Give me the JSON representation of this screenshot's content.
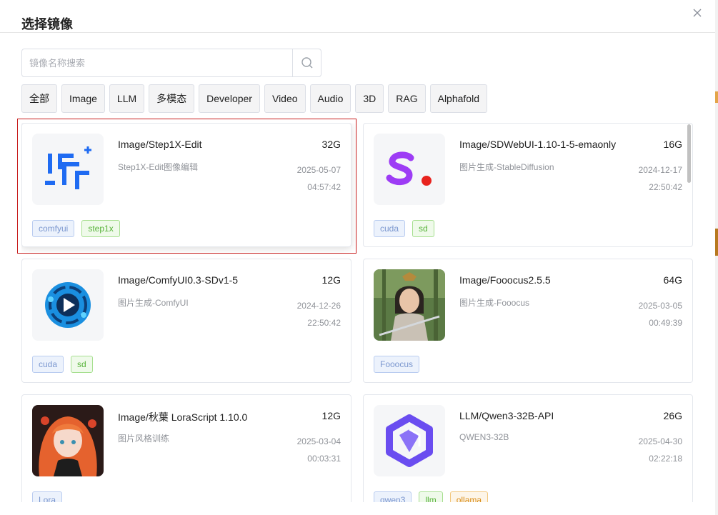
{
  "dialog": {
    "title": "选择镜像",
    "search": {
      "placeholder": "镜像名称搜索",
      "value": ""
    },
    "filters": [
      "全部",
      "Image",
      "LLM",
      "多模态",
      "Developer",
      "Video",
      "Audio",
      "3D",
      "RAG",
      "Alphafold"
    ]
  },
  "images": [
    {
      "name": "Image/Step1X-Edit",
      "size": "32G",
      "desc": "Step1X-Edit图像编辑",
      "date": "2025-05-07",
      "time": "04:57:42",
      "tags": [
        {
          "label": "comfyui",
          "color": "blue"
        },
        {
          "label": "step1x",
          "color": "green"
        }
      ],
      "icon": "step1x-logo",
      "selected": true
    },
    {
      "name": "Image/SDWebUI-1.10-1-5-emaonly",
      "size": "16G",
      "desc": "图片生成-StableDiffusion",
      "date": "2024-12-17",
      "time": "22:50:42",
      "tags": [
        {
          "label": "cuda",
          "color": "blue"
        },
        {
          "label": "sd",
          "color": "green"
        }
      ],
      "icon": "stability-logo",
      "selected": false
    },
    {
      "name": "Image/ComfyUI0.3-SDv1-5",
      "size": "12G",
      "desc": "图片生成-ComfyUI",
      "date": "2024-12-26",
      "time": "22:50:42",
      "tags": [
        {
          "label": "cuda",
          "color": "blue"
        },
        {
          "label": "sd",
          "color": "green"
        }
      ],
      "icon": "comfyui-logo",
      "selected": false
    },
    {
      "name": "Image/Fooocus2.5.5",
      "size": "64G",
      "desc": "图片生成-Fooocus",
      "date": "2025-03-05",
      "time": "00:49:39",
      "tags": [
        {
          "label": "Fooocus",
          "color": "blue"
        }
      ],
      "icon": "fooocus-portrait",
      "selected": false
    },
    {
      "name": "Image/秋葉 LoraScript 1.10.0",
      "size": "12G",
      "desc": "图片风格训练",
      "date": "2025-03-04",
      "time": "00:03:31",
      "tags": [
        {
          "label": "Lora",
          "color": "blue"
        }
      ],
      "icon": "anime-portrait",
      "selected": false
    },
    {
      "name": "LLM/Qwen3-32B-API",
      "size": "26G",
      "desc": "QWEN3-32B",
      "date": "2025-04-30",
      "time": "02:22:18",
      "tags": [
        {
          "label": "qwen3",
          "color": "blue"
        },
        {
          "label": "llm",
          "color": "green"
        },
        {
          "label": "ollama",
          "color": "orange"
        }
      ],
      "icon": "qwen-logo",
      "selected": false
    }
  ],
  "colors": {
    "accent": "#c81e1e",
    "tag_blue": "#7b97cf",
    "tag_green": "#58b33a",
    "tag_orange": "#d98d17"
  }
}
